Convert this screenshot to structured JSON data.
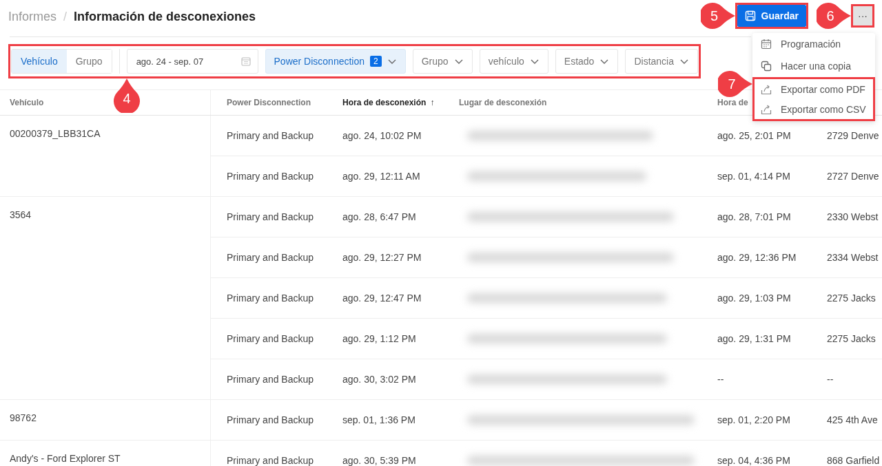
{
  "breadcrumb": {
    "parent": "Informes",
    "separator": "/",
    "title": "Información de desconexiones"
  },
  "actions": {
    "save": "Guardar",
    "more": "···"
  },
  "menu": [
    {
      "kind": "calendar",
      "label": "Programación"
    },
    {
      "kind": "copy",
      "label": "Hacer una copia"
    },
    {
      "kind": "export",
      "label": "Exportar como PDF"
    },
    {
      "kind": "export",
      "label": "Exportar como CSV"
    }
  ],
  "segments": [
    {
      "label": "Vehículo",
      "selected": true
    },
    {
      "label": "Grupo",
      "selected": false
    }
  ],
  "date_range": "ago. 24 - sep. 07",
  "filters": [
    {
      "label": "Power Disconnection",
      "count": "2",
      "active": true
    },
    {
      "label": "Grupo",
      "active": false
    },
    {
      "label": "vehículo",
      "active": false
    },
    {
      "label": "Estado",
      "active": false
    },
    {
      "label": "Distancia",
      "active": false
    }
  ],
  "table": {
    "columns": [
      {
        "label": "Vehículo"
      },
      {
        "label": "Power Disconnection"
      },
      {
        "label": "Hora de desconexión",
        "sort": "↑"
      },
      {
        "label": "Lugar de desconexión"
      },
      {
        "label": "Hora de"
      }
    ],
    "groups": [
      {
        "vehicle": "00200379_LBB31CA",
        "rows": [
          {
            "power": "Primary and Backup",
            "time": "ago. 24, 10:02 PM",
            "reconnect": "ago. 25, 2:01 PM",
            "column_6": "2729 Denve"
          },
          {
            "power": "Primary and Backup",
            "time": "ago. 29, 12:11 AM",
            "reconnect": "sep. 01, 4:14 PM",
            "column_6": "2727 Denve"
          }
        ]
      },
      {
        "vehicle": "3564",
        "rows": [
          {
            "power": "Primary and Backup",
            "time": "ago. 28, 6:47 PM",
            "reconnect": "ago. 28, 7:01 PM",
            "column_6": "2330 Webst"
          },
          {
            "power": "Primary and Backup",
            "time": "ago. 29, 12:27 PM",
            "reconnect": "ago. 29, 12:36 PM",
            "column_6": "2334 Webst"
          },
          {
            "power": "Primary and Backup",
            "time": "ago. 29, 12:47 PM",
            "reconnect": "ago. 29, 1:03 PM",
            "column_6": "2275 Jacks"
          },
          {
            "power": "Primary and Backup",
            "time": "ago. 29, 1:12 PM",
            "reconnect": "ago. 29, 1:31 PM",
            "column_6": "2275 Jacks"
          },
          {
            "power": "Primary and Backup",
            "time": "ago. 30, 3:02 PM",
            "reconnect": "--",
            "column_6": "--"
          }
        ]
      },
      {
        "vehicle": "98762",
        "rows": [
          {
            "power": "Primary and Backup",
            "time": "sep. 01, 1:36 PM",
            "reconnect": "sep. 01, 2:20 PM",
            "column_6": "425 4th Ave"
          }
        ]
      },
      {
        "vehicle": "Andy's - Ford Explorer ST",
        "rows": [
          {
            "power": "Primary and Backup",
            "time": "ago. 30, 5:39 PM",
            "reconnect": "sep. 04, 4:36 PM",
            "column_6": "868 Garfield"
          }
        ]
      }
    ]
  },
  "annotations": [
    {
      "number": "4"
    },
    {
      "number": "5"
    },
    {
      "number": "6"
    },
    {
      "number": "7"
    }
  ]
}
